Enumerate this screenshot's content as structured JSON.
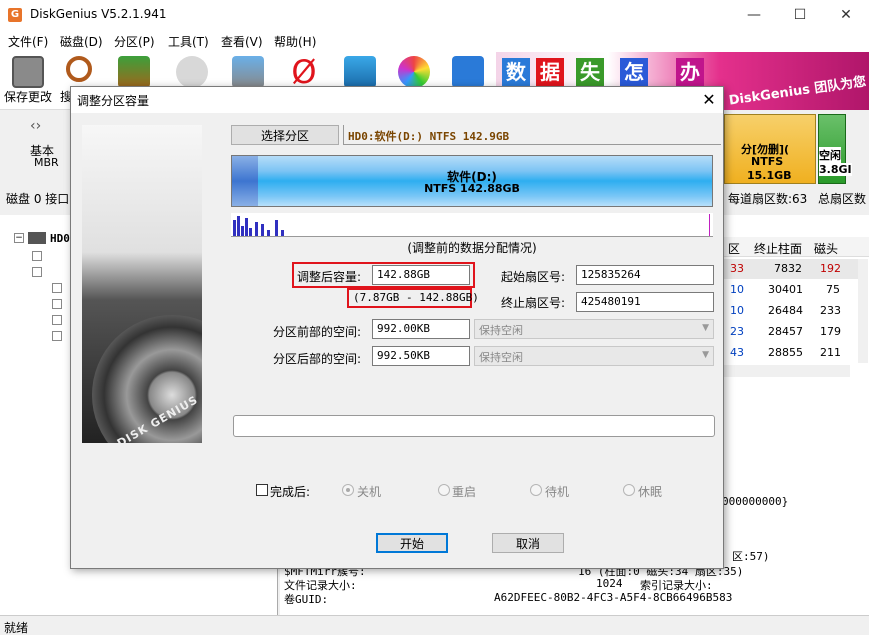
{
  "app": {
    "title": "DiskGenius V5.2.1.941",
    "icon_letter": "G"
  },
  "menu": [
    "文件(F)",
    "磁盘(D)",
    "分区(P)",
    "工具(T)",
    "查看(V)",
    "帮助(H)"
  ],
  "toolbar": {
    "save_label": "保存更改",
    "next_label": "搜"
  },
  "banner": {
    "tiles": [
      "数",
      "据",
      "失",
      "怎",
      "办"
    ],
    "text": "DiskGenius 团队为您"
  },
  "diskbar": {
    "basic": "基本",
    "mbr": "MBR",
    "disk_info": "磁盘 0 接口",
    "right_part_label": "分[勿删](",
    "right_part_fs": "NTFS",
    "right_part_size": "15.1GB",
    "free_label": "空闲",
    "free_size": "3.8GI",
    "sectors_per_track": "每道扇区数:63",
    "total_sectors": "总扇区数"
  },
  "tree": {
    "root": "HD0"
  },
  "table": {
    "headers": [
      "区",
      "终止柱面",
      "磁头"
    ],
    "rows": [
      [
        "33",
        "7832",
        "192"
      ],
      [
        "10",
        "30401",
        "75"
      ],
      [
        "10",
        "26484",
        "233"
      ],
      [
        "23",
        "28457",
        "179"
      ],
      [
        "43",
        "28855",
        "211"
      ]
    ]
  },
  "details": {
    "guid_part": "000000000}",
    "line_57": "区:57)",
    "line_mft": "$MFTMirr簇号:",
    "mft_value": "16 (柱面:0 磁头:34 扇区:35)",
    "file_record_label": "文件记录大小:",
    "file_record_value": "1024",
    "index_label": "索引记录大小:",
    "guid_label": "卷GUID:",
    "guid_value": "A62DFEEC-80B2-4FC3-A5F4-8CB66496B583"
  },
  "status": "就绪",
  "dialog": {
    "title": "调整分区容量",
    "select_partition_button": "选择分区",
    "partition_info": "HD0:软件(D:) NTFS 142.9GB",
    "partition_name": "软件(D:)",
    "partition_fs_size": "NTFS 142.88GB",
    "hdd_label": "DISK GENIUS",
    "dist_caption": "(调整前的数据分配情况)",
    "new_size_label": "调整后容量:",
    "new_size_value": "142.88GB",
    "range_text": "(7.87GB - 142.88GB)",
    "start_sector_label": "起始扇区号:",
    "start_sector_value": "125835264",
    "end_sector_label": "终止扇区号:",
    "end_sector_value": "425480191",
    "before_space_label": "分区前部的空间:",
    "before_space_value": "992.00KB",
    "before_space_option": "保持空闲",
    "after_space_label": "分区后部的空间:",
    "after_space_value": "992.50KB",
    "after_space_option": "保持空闲",
    "after_done_label": "完成后:",
    "options": [
      "关机",
      "重启",
      "待机",
      "休眠"
    ],
    "start_button": "开始",
    "cancel_button": "取消"
  },
  "colors": {
    "accent": "#0078d7",
    "highlight": "#e0141c",
    "partition": "#2eaef0"
  }
}
